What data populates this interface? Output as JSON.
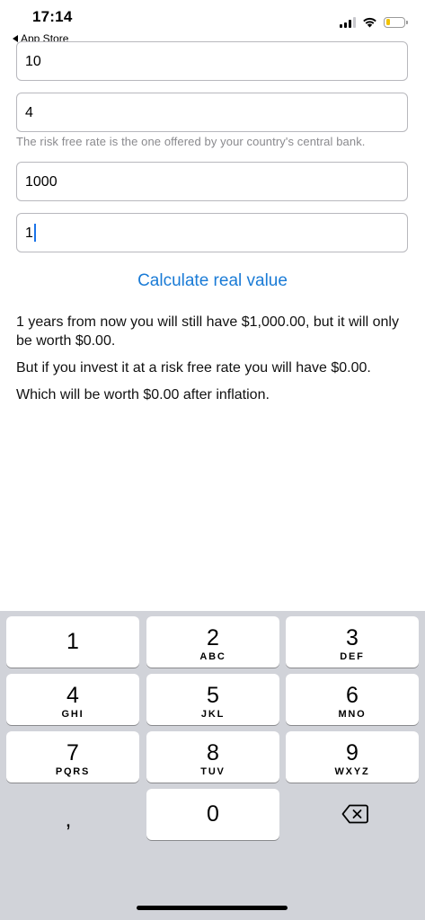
{
  "status_bar": {
    "time": "17:14",
    "back_label": "App Store",
    "battery_color": "#f2c200"
  },
  "form": {
    "field1_value": "10",
    "field2_value": "4",
    "hint": "The risk free rate is the one offered by your country's central bank.",
    "field3_value": "1000",
    "field4_value": "1"
  },
  "calculate_label": "Calculate real value",
  "results": {
    "line1": "1 years from now you will still have $1,000.00, but it will only be worth $0.00.",
    "line2": "But if you invest it at a risk free rate you will have $0.00.",
    "line3": "Which will be worth $0.00 after inflation."
  },
  "keyboard": {
    "keys": [
      {
        "digit": "1",
        "letters": ""
      },
      {
        "digit": "2",
        "letters": "ABC"
      },
      {
        "digit": "3",
        "letters": "DEF"
      },
      {
        "digit": "4",
        "letters": "GHI"
      },
      {
        "digit": "5",
        "letters": "JKL"
      },
      {
        "digit": "6",
        "letters": "MNO"
      },
      {
        "digit": "7",
        "letters": "PQRS"
      },
      {
        "digit": "8",
        "letters": "TUV"
      },
      {
        "digit": "9",
        "letters": "WXYZ"
      },
      {
        "digit": "0",
        "letters": ""
      }
    ],
    "comma": ","
  },
  "colors": {
    "accent": "#1a7bd6",
    "keyboard_bg": "#d1d3d9"
  }
}
